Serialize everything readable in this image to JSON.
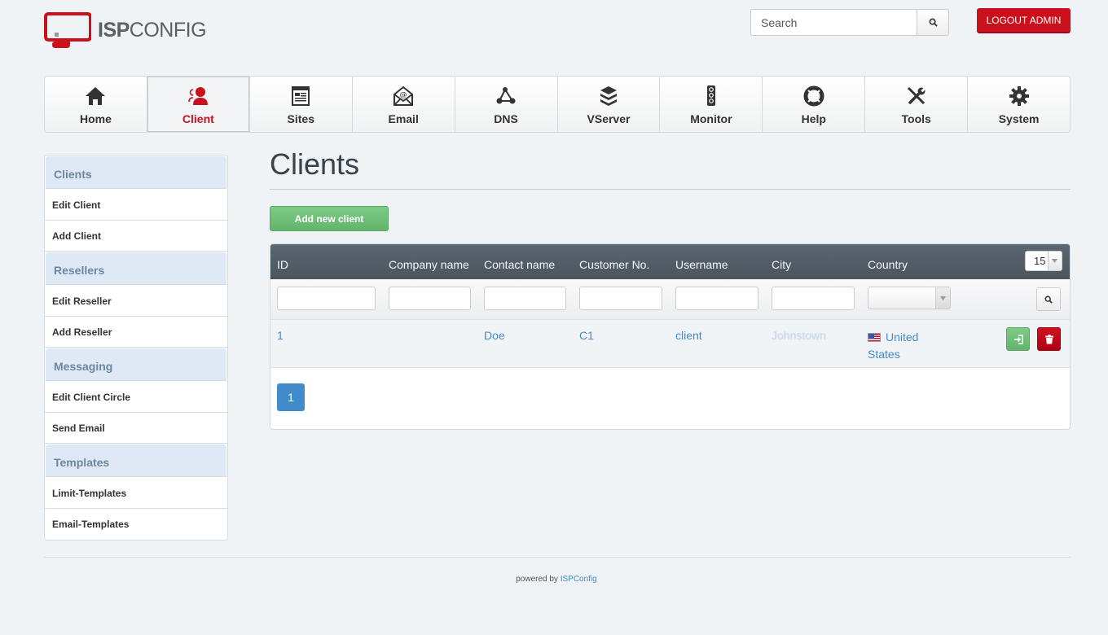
{
  "brand": {
    "logo_bold": "ISP",
    "logo_light": "CONFIG",
    "accent": "#c9101b"
  },
  "header": {
    "search_placeholder": "Search",
    "search_value": "",
    "logout_label": "LOGOUT ADMIN"
  },
  "nav": {
    "tabs": [
      {
        "label": "Home",
        "icon": "home-icon",
        "active": false
      },
      {
        "label": "Client",
        "icon": "client-icon",
        "active": true
      },
      {
        "label": "Sites",
        "icon": "sites-icon",
        "active": false
      },
      {
        "label": "Email",
        "icon": "email-icon",
        "active": false
      },
      {
        "label": "DNS",
        "icon": "dns-icon",
        "active": false
      },
      {
        "label": "VServer",
        "icon": "vserver-icon",
        "active": false
      },
      {
        "label": "Monitor",
        "icon": "monitor-icon",
        "active": false
      },
      {
        "label": "Help",
        "icon": "lifebuoy-icon",
        "active": false
      },
      {
        "label": "Tools",
        "icon": "tools-icon",
        "active": false
      },
      {
        "label": "System",
        "icon": "gear-icon",
        "active": false
      }
    ]
  },
  "sidebar": {
    "groups": [
      {
        "title": "Clients",
        "items": [
          "Edit Client",
          "Add Client"
        ]
      },
      {
        "title": "Resellers",
        "items": [
          "Edit Reseller",
          "Add Reseller"
        ]
      },
      {
        "title": "Messaging",
        "items": [
          "Edit Client Circle",
          "Send Email"
        ]
      },
      {
        "title": "Templates",
        "items": [
          "Limit-Templates",
          "Email-Templates"
        ]
      }
    ]
  },
  "main": {
    "title": "Clients",
    "add_button_label": "Add new client",
    "table": {
      "columns": [
        "ID",
        "Company name",
        "Contact name",
        "Customer No.",
        "Username",
        "City",
        "Country"
      ],
      "per_page": "15",
      "country_filter_value": "",
      "rows": [
        {
          "id": "1",
          "company_name": "",
          "contact_name": "Doe",
          "customer_no": "C1",
          "username": "client",
          "city": "Johnstown",
          "country": "United States",
          "country_flag": "us-flag-icon"
        }
      ]
    },
    "pagination": {
      "current_page": "1"
    }
  },
  "footer": {
    "prefix": "powered by",
    "link_label": "ISPConfig"
  }
}
